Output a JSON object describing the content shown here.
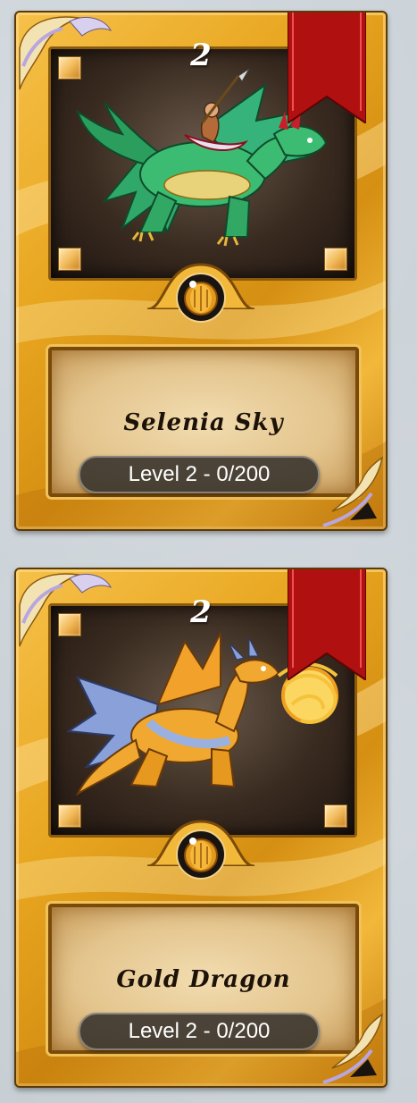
{
  "cards": [
    {
      "name": "Selenia Sky",
      "level_text": "Level 2 - 0/200",
      "rank_badge": "2",
      "creature": "green dragon with rider",
      "icons": {
        "mana": "gold-coin-icon"
      }
    },
    {
      "name": "Gold Dragon",
      "level_text": "Level 2 - 0/200",
      "rank_badge": "2",
      "creature": "golden dragon breathing fire",
      "icons": {
        "mana": "gold-coin-icon"
      }
    }
  ],
  "colors": {
    "card_gold": "#e8a620",
    "banner_red": "#b01010",
    "parchment": "#e3c48c",
    "pill_bg": "#3a342e",
    "background": "#c7cfd5"
  }
}
